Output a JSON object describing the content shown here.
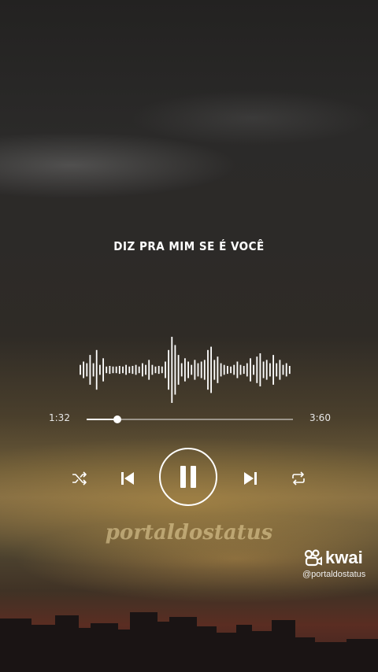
{
  "song": {
    "lyric_line": "DIZ PRA MIM SE É VOCÊ"
  },
  "player": {
    "elapsed": "1:32",
    "total": "3:60",
    "progress": 0.15,
    "controls": [
      "shuffle-icon",
      "previous-icon",
      "pause-icon",
      "next-icon",
      "repeat-icon"
    ]
  },
  "waveform_levels": [
    0.15,
    0.25,
    0.2,
    0.45,
    0.2,
    0.6,
    0.15,
    0.35,
    0.1,
    0.12,
    0.1,
    0.1,
    0.12,
    0.1,
    0.15,
    0.1,
    0.12,
    0.15,
    0.1,
    0.2,
    0.15,
    0.3,
    0.15,
    0.1,
    0.12,
    0.1,
    0.25,
    0.6,
    1.0,
    0.75,
    0.45,
    0.2,
    0.35,
    0.25,
    0.15,
    0.3,
    0.2,
    0.25,
    0.3,
    0.6,
    0.7,
    0.3,
    0.4,
    0.2,
    0.15,
    0.12,
    0.1,
    0.15,
    0.25,
    0.15,
    0.12,
    0.2,
    0.35,
    0.15,
    0.4,
    0.5,
    0.25,
    0.3,
    0.2,
    0.45,
    0.2,
    0.3,
    0.15,
    0.2,
    0.12
  ],
  "branding": {
    "watermark": "portaldostatus",
    "app_name": "kwai",
    "handle": "@portaldostatus"
  },
  "colors": {
    "foreground": "#ffffff"
  }
}
